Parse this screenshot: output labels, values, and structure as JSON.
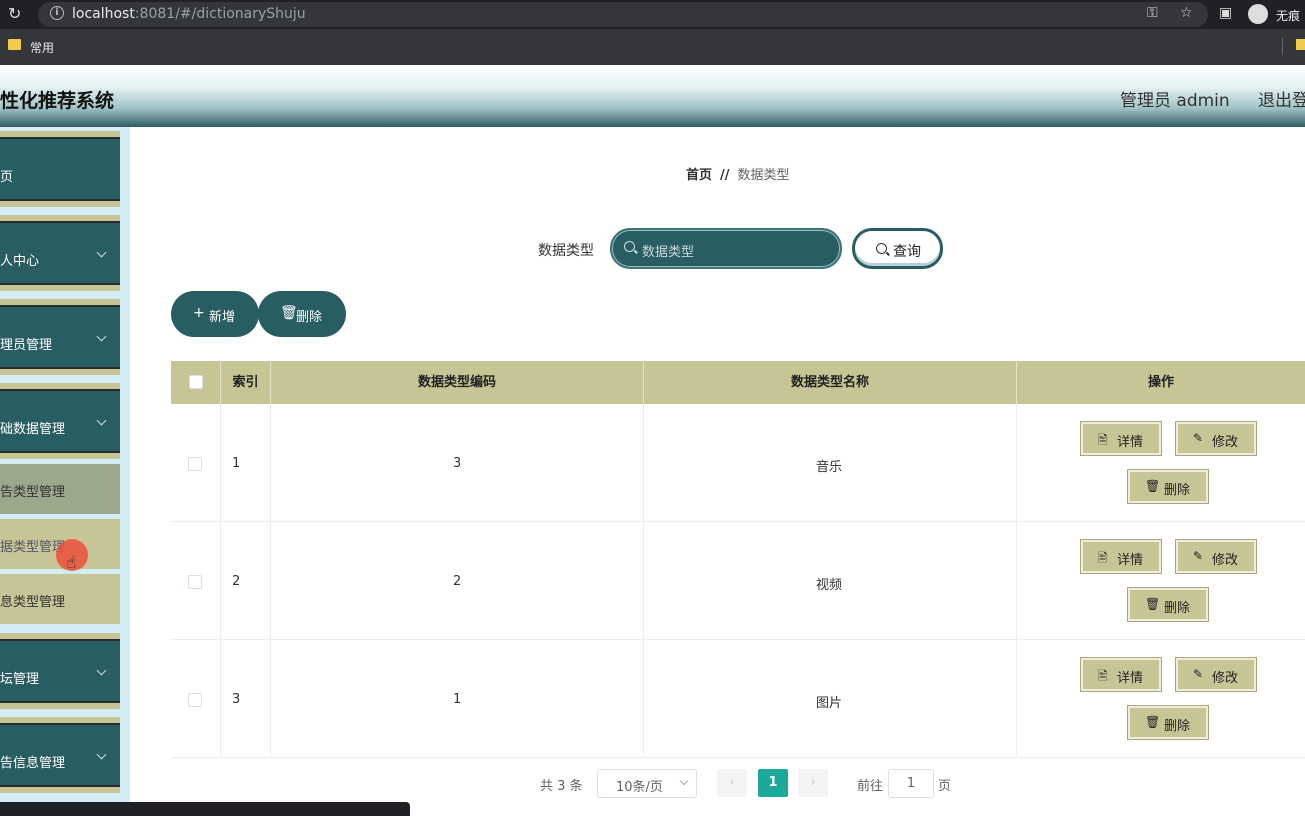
{
  "browser": {
    "url_host": "localhost",
    "url_rest": ":8081/#/dictionaryShuju",
    "bookmark": "常用",
    "profile_label": "无痕"
  },
  "header": {
    "title": "性化推荐系统",
    "user": "管理员 admin",
    "logout": "退出登"
  },
  "sidebar": {
    "menus": [
      {
        "label": "页"
      },
      {
        "label": "人中心"
      },
      {
        "label": "理员管理"
      },
      {
        "label": "础数据管理"
      }
    ],
    "submenus": [
      {
        "label": "告类型管理"
      },
      {
        "label": "据类型管理"
      },
      {
        "label": "息类型管理"
      }
    ],
    "menus_after": [
      {
        "label": "坛管理"
      },
      {
        "label": "告信息管理"
      }
    ]
  },
  "breadcrumb": {
    "home": "首页",
    "sep": "//",
    "current": "数据类型"
  },
  "search": {
    "label": "数据类型",
    "placeholder": "数据类型",
    "button": "查询"
  },
  "toolbar": {
    "add": "新增",
    "delete": "删除"
  },
  "table": {
    "columns": [
      "索引",
      "数据类型编码",
      "数据类型名称",
      "操作"
    ],
    "rows": [
      {
        "index": "1",
        "code": "3",
        "name": "音乐"
      },
      {
        "index": "2",
        "code": "2",
        "name": "视频"
      },
      {
        "index": "3",
        "code": "1",
        "name": "图片"
      }
    ],
    "actions": {
      "detail": "详情",
      "edit": "修改",
      "delete": "删除"
    }
  },
  "pagination": {
    "total": "共 3 条",
    "page_size": "10条/页",
    "current": "1",
    "goto_label": "前往",
    "goto_value": "1",
    "page_label": "页"
  }
}
